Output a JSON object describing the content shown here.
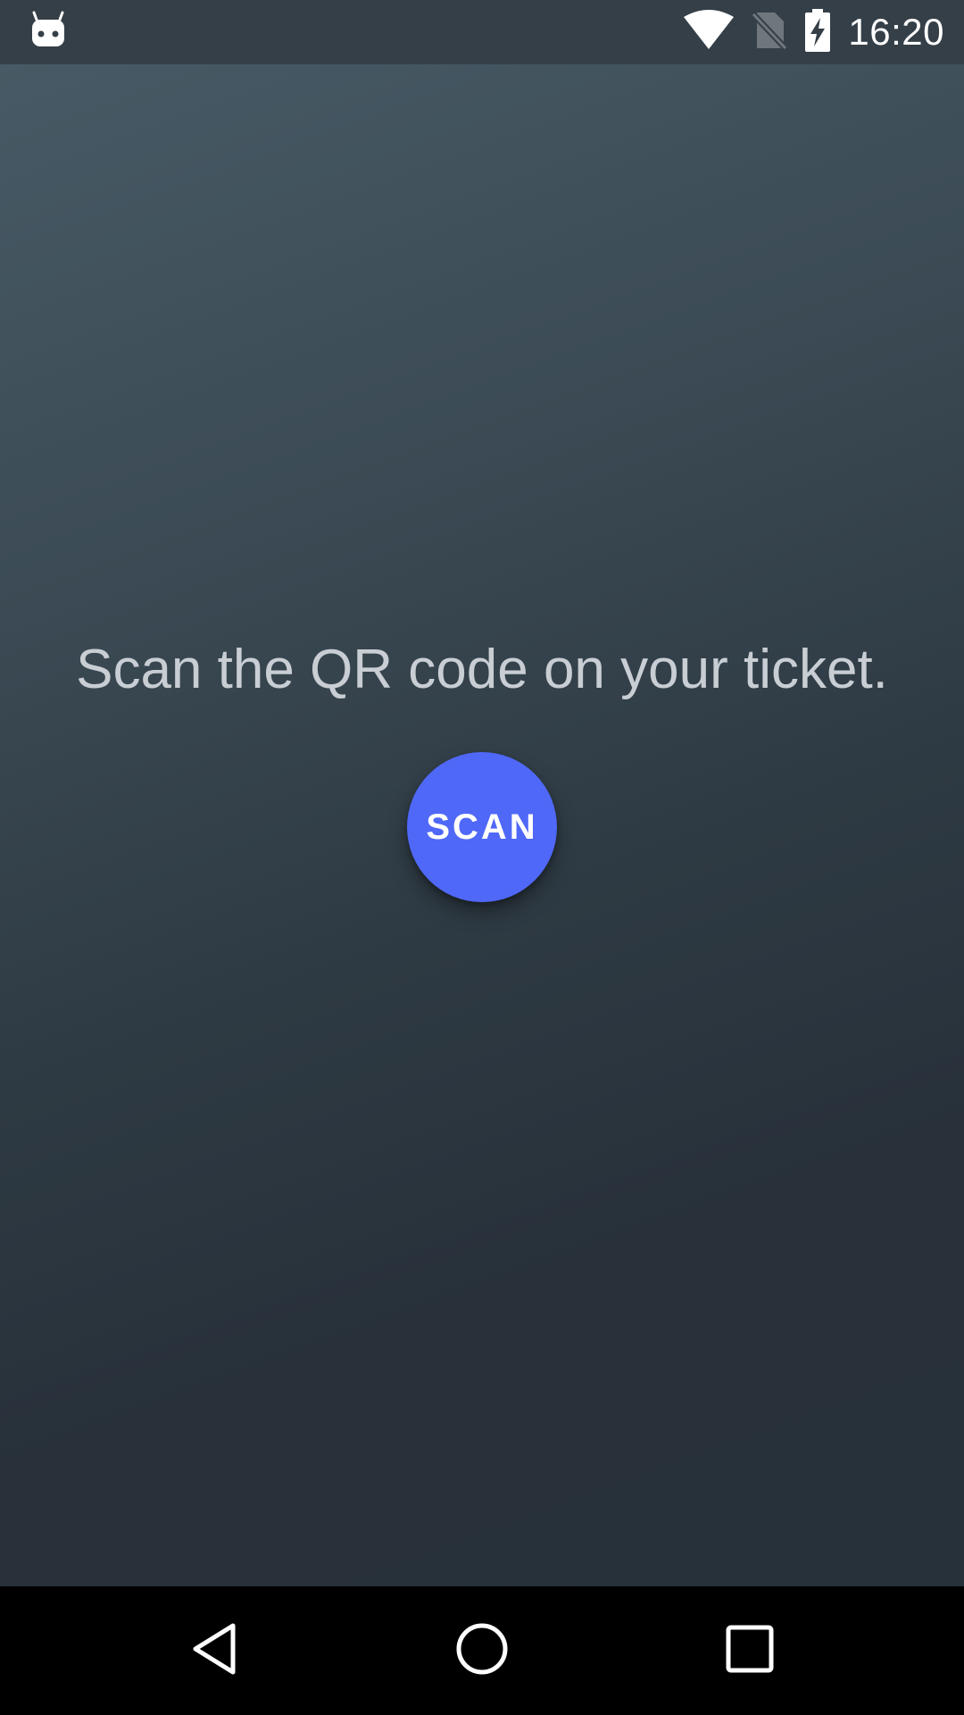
{
  "status_bar": {
    "time": "16:20",
    "icons": [
      "android-notification-icon",
      "wifi-icon",
      "no-sim-icon",
      "battery-charging-icon"
    ]
  },
  "main": {
    "prompt": "Scan the QR code on your ticket.",
    "scan_button_label": "SCAN"
  },
  "nav_bar": {
    "buttons": [
      "back-icon",
      "home-icon",
      "recents-icon"
    ]
  },
  "colors": {
    "accent": "#5068f7",
    "status_bar": "#353f48",
    "nav_bar": "#000000",
    "prompt_text": "#c8ced3"
  }
}
